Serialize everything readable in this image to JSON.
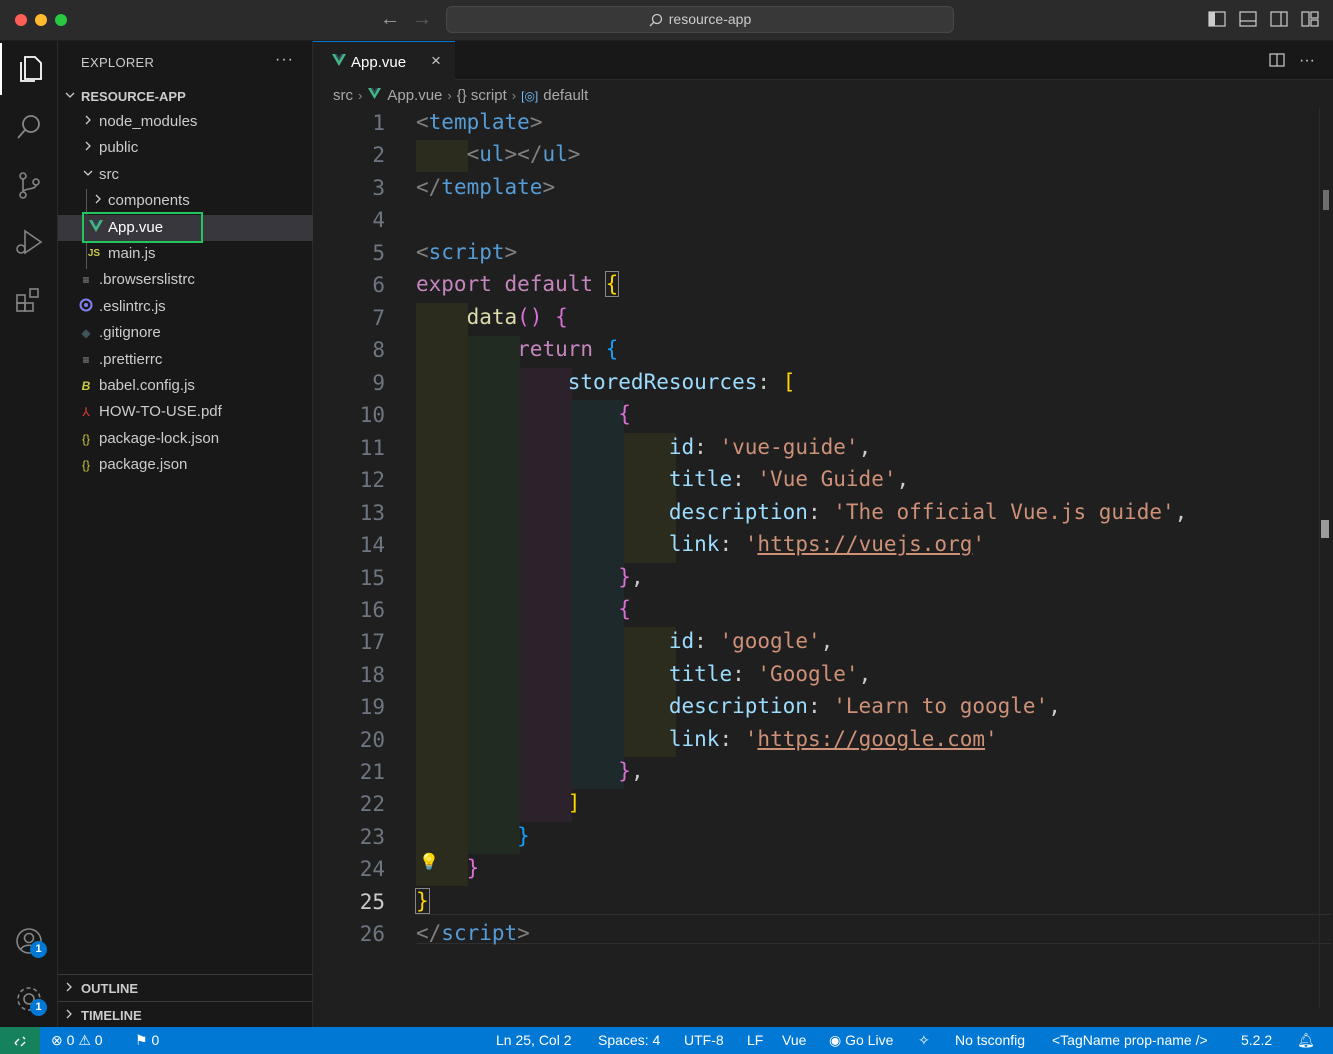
{
  "window": {
    "search_text": "resource-app"
  },
  "sidebar": {
    "title": "EXPLORER",
    "root": "RESOURCE-APP",
    "items": [
      {
        "label": "node_modules",
        "kind": "folder"
      },
      {
        "label": "public",
        "kind": "folder"
      },
      {
        "label": "src",
        "kind": "folder-open"
      },
      {
        "label": "components",
        "kind": "folder"
      },
      {
        "label": "App.vue",
        "kind": "vue"
      },
      {
        "label": "main.js",
        "kind": "js"
      },
      {
        "label": ".browserslistrc",
        "kind": "text"
      },
      {
        "label": ".eslintrc.js",
        "kind": "eslint"
      },
      {
        "label": ".gitignore",
        "kind": "git"
      },
      {
        "label": ".prettierrc",
        "kind": "text"
      },
      {
        "label": "babel.config.js",
        "kind": "babel"
      },
      {
        "label": "HOW-TO-USE.pdf",
        "kind": "pdf"
      },
      {
        "label": "package-lock.json",
        "kind": "json"
      },
      {
        "label": "package.json",
        "kind": "json"
      }
    ],
    "outline": "OUTLINE",
    "timeline": "TIMELINE"
  },
  "tab": {
    "label": "App.vue",
    "close": "×"
  },
  "breadcrumb": {
    "p1": "src",
    "p2": "App.vue",
    "p3": "{} script",
    "p4": "default"
  },
  "editor": {
    "cursor_line": 25,
    "line_numbers": [
      "1",
      "2",
      "3",
      "4",
      "5",
      "6",
      "7",
      "8",
      "9",
      "10",
      "11",
      "12",
      "13",
      "14",
      "15",
      "16",
      "17",
      "18",
      "19",
      "20",
      "21",
      "22",
      "23",
      "24",
      "25",
      "26"
    ]
  },
  "activity": {
    "accounts_badge": "1",
    "settings_badge": "1"
  },
  "statusbar": {
    "errors": "0",
    "warnings": "0",
    "ports": "0",
    "position": "Ln 25, Col 2",
    "spaces": "Spaces: 4",
    "encoding": "UTF-8",
    "eol": "LF",
    "language": "Vue",
    "golive": "Go Live",
    "tsconfig": "No tsconfig",
    "tagname": "<TagName prop-name />",
    "version": "5.2.2"
  },
  "colors": {
    "accent": "#0078d4",
    "selection_outline": "#22c55e",
    "vue_green": "#42b883"
  }
}
